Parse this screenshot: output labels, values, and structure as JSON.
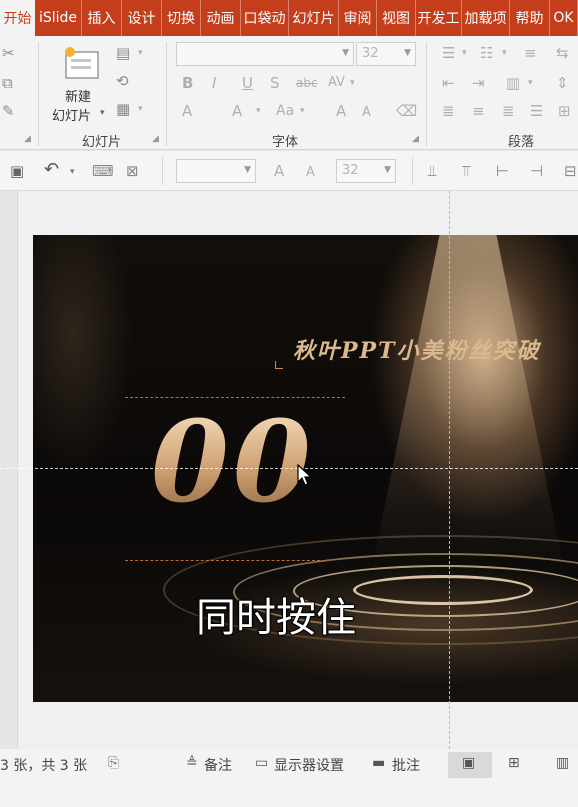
{
  "ribbon_tabs": [
    "开始",
    "iSlide",
    "插入",
    "设计",
    "切换",
    "动画",
    "口袋动",
    "幻灯片",
    "审阅",
    "视图",
    "开发工",
    "加载项",
    "帮助",
    "OK"
  ],
  "ribbon": {
    "new_slide_label_1": "新建",
    "new_slide_label_2": "幻灯片",
    "group_slides": "幻灯片",
    "group_font": "字体",
    "group_paragraph": "段落",
    "font_size_value": "32"
  },
  "qat": {
    "font_size_value": "32"
  },
  "slide": {
    "title": "秋叶PPT小美粉丝突破",
    "number": "00",
    "subtitle": "同时按住"
  },
  "status": {
    "slide_count": "3 张，共 3 张",
    "notes": "备注",
    "display_settings": "显示器设置",
    "comments": "批注"
  },
  "colors": {
    "accent": "#c43e1c"
  }
}
